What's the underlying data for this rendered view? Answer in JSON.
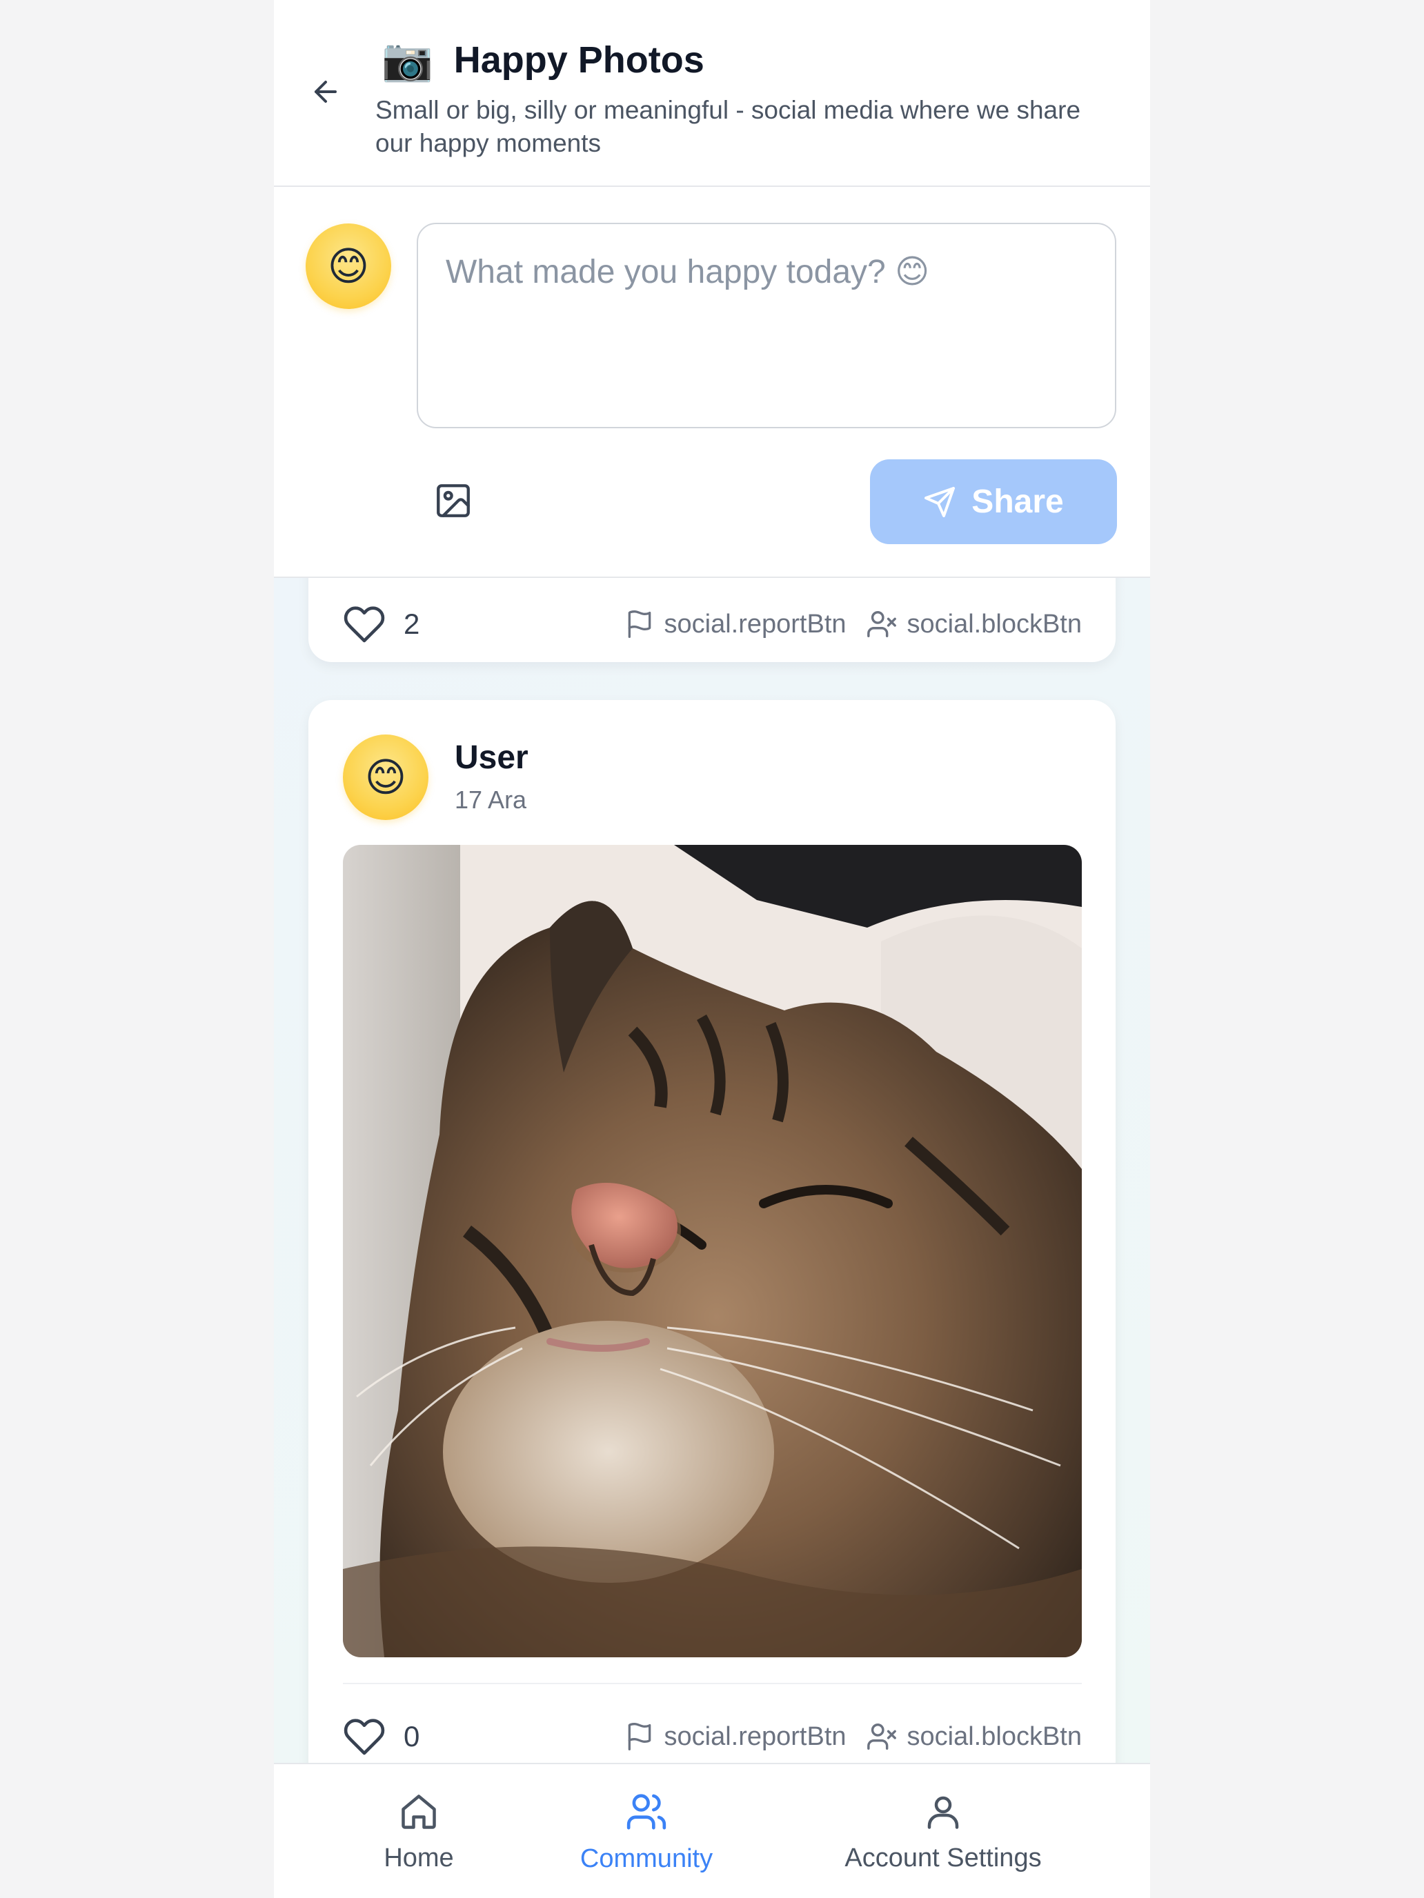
{
  "header": {
    "camera_emoji": "📷",
    "title": "Happy Photos",
    "subtitle": "Small or big, silly or meaningful - social media where we share our happy moments"
  },
  "composer": {
    "avatar_emoji": "😊",
    "placeholder": "What made you happy today? 😊",
    "value": "",
    "share_label": "Share",
    "share_color": "#a5c8fb"
  },
  "feed": {
    "previous_post": {
      "like_count": "2",
      "report_label": "social.reportBtn",
      "block_label": "social.blockBtn"
    },
    "post": {
      "avatar_emoji": "😊",
      "author": "User",
      "date": "17 Ara",
      "photo": "sleeping-tabby-cat-photo",
      "like_count": "0",
      "report_label": "social.reportBtn",
      "block_label": "social.blockBtn"
    }
  },
  "nav": {
    "items": [
      {
        "label": "Home",
        "icon": "home-icon",
        "active": false
      },
      {
        "label": "Community",
        "icon": "users-icon",
        "active": true
      },
      {
        "label": "Account Settings",
        "icon": "user-icon",
        "active": false
      }
    ],
    "active_color": "#3b82f6"
  }
}
